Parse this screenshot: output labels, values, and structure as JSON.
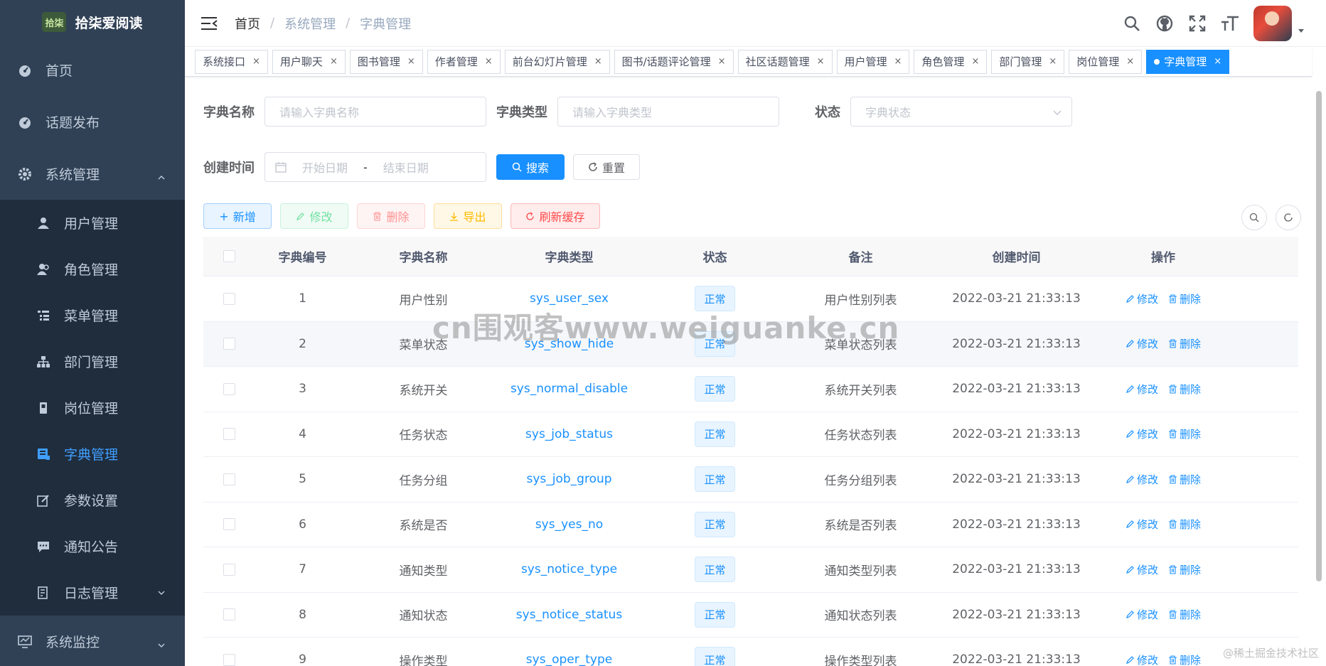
{
  "app": {
    "logo_mark": "拾柒",
    "title": "拾柒爱阅读"
  },
  "sidebar": {
    "top": [
      {
        "label": "首页",
        "icon": "dashboard-icon"
      },
      {
        "label": "话题发布",
        "icon": "dashboard-icon"
      },
      {
        "label": "系统管理",
        "icon": "gear-icon"
      }
    ],
    "sub": [
      {
        "label": "用户管理",
        "icon": "user-icon"
      },
      {
        "label": "角色管理",
        "icon": "peoples-icon"
      },
      {
        "label": "菜单管理",
        "icon": "tree-table-icon"
      },
      {
        "label": "部门管理",
        "icon": "tree-icon"
      },
      {
        "label": "岗位管理",
        "icon": "post-icon"
      },
      {
        "label": "字典管理",
        "icon": "dict-icon",
        "active": true
      },
      {
        "label": "参数设置",
        "icon": "edit-icon"
      },
      {
        "label": "通知公告",
        "icon": "message-icon"
      },
      {
        "label": "日志管理",
        "icon": "log-icon"
      }
    ],
    "bottom": {
      "label": "系统监控",
      "icon": "monitor-icon"
    }
  },
  "breadcrumb": [
    "首页",
    "系统管理",
    "字典管理"
  ],
  "tags": [
    "系统接口",
    "用户聊天",
    "图书管理",
    "作者管理",
    "前台幻灯片管理",
    "图书/话题评论管理",
    "社区话题管理",
    "用户管理",
    "角色管理",
    "部门管理",
    "岗位管理",
    "字典管理"
  ],
  "search": {
    "dict_name_label": "字典名称",
    "dict_name_placeholder": "请输入字典名称",
    "dict_type_label": "字典类型",
    "dict_type_placeholder": "请输入字典类型",
    "status_label": "状态",
    "status_placeholder": "字典状态",
    "created_label": "创建时间",
    "start_placeholder": "开始日期",
    "range_sep": "-",
    "end_placeholder": "结束日期",
    "search_btn": "搜索",
    "reset_btn": "重置"
  },
  "toolbar": {
    "add": "新增",
    "edit": "修改",
    "delete": "删除",
    "export": "导出",
    "refresh_cache": "刷新缓存"
  },
  "table": {
    "headers": [
      "字典编号",
      "字典名称",
      "字典类型",
      "状态",
      "备注",
      "创建时间",
      "操作"
    ],
    "rows": [
      {
        "id": "1",
        "name": "用户性别",
        "type": "sys_user_sex",
        "status": "正常",
        "remark": "用户性别列表",
        "time": "2022-03-21 21:33:13"
      },
      {
        "id": "2",
        "name": "菜单状态",
        "type": "sys_show_hide",
        "status": "正常",
        "remark": "菜单状态列表",
        "time": "2022-03-21 21:33:13"
      },
      {
        "id": "3",
        "name": "系统开关",
        "type": "sys_normal_disable",
        "status": "正常",
        "remark": "系统开关列表",
        "time": "2022-03-21 21:33:13"
      },
      {
        "id": "4",
        "name": "任务状态",
        "type": "sys_job_status",
        "status": "正常",
        "remark": "任务状态列表",
        "time": "2022-03-21 21:33:13"
      },
      {
        "id": "5",
        "name": "任务分组",
        "type": "sys_job_group",
        "status": "正常",
        "remark": "任务分组列表",
        "time": "2022-03-21 21:33:13"
      },
      {
        "id": "6",
        "name": "系统是否",
        "type": "sys_yes_no",
        "status": "正常",
        "remark": "系统是否列表",
        "time": "2022-03-21 21:33:13"
      },
      {
        "id": "7",
        "name": "通知类型",
        "type": "sys_notice_type",
        "status": "正常",
        "remark": "通知类型列表",
        "time": "2022-03-21 21:33:13"
      },
      {
        "id": "8",
        "name": "通知状态",
        "type": "sys_notice_status",
        "status": "正常",
        "remark": "通知状态列表",
        "time": "2022-03-21 21:33:13"
      },
      {
        "id": "9",
        "name": "操作类型",
        "type": "sys_oper_type",
        "status": "正常",
        "remark": "操作类型列表",
        "time": "2022-03-21 21:33:13"
      }
    ],
    "op_edit": "修改",
    "op_delete": "删除"
  },
  "watermark": "cn围观客www.weiguanke.cn",
  "corner_watermark": "@稀土掘金技术社区",
  "colors": {
    "sidebar_bg": "#304156",
    "submenu_bg": "#1f2d3d",
    "primary": "#1890ff",
    "active_menu": "#409eff"
  }
}
